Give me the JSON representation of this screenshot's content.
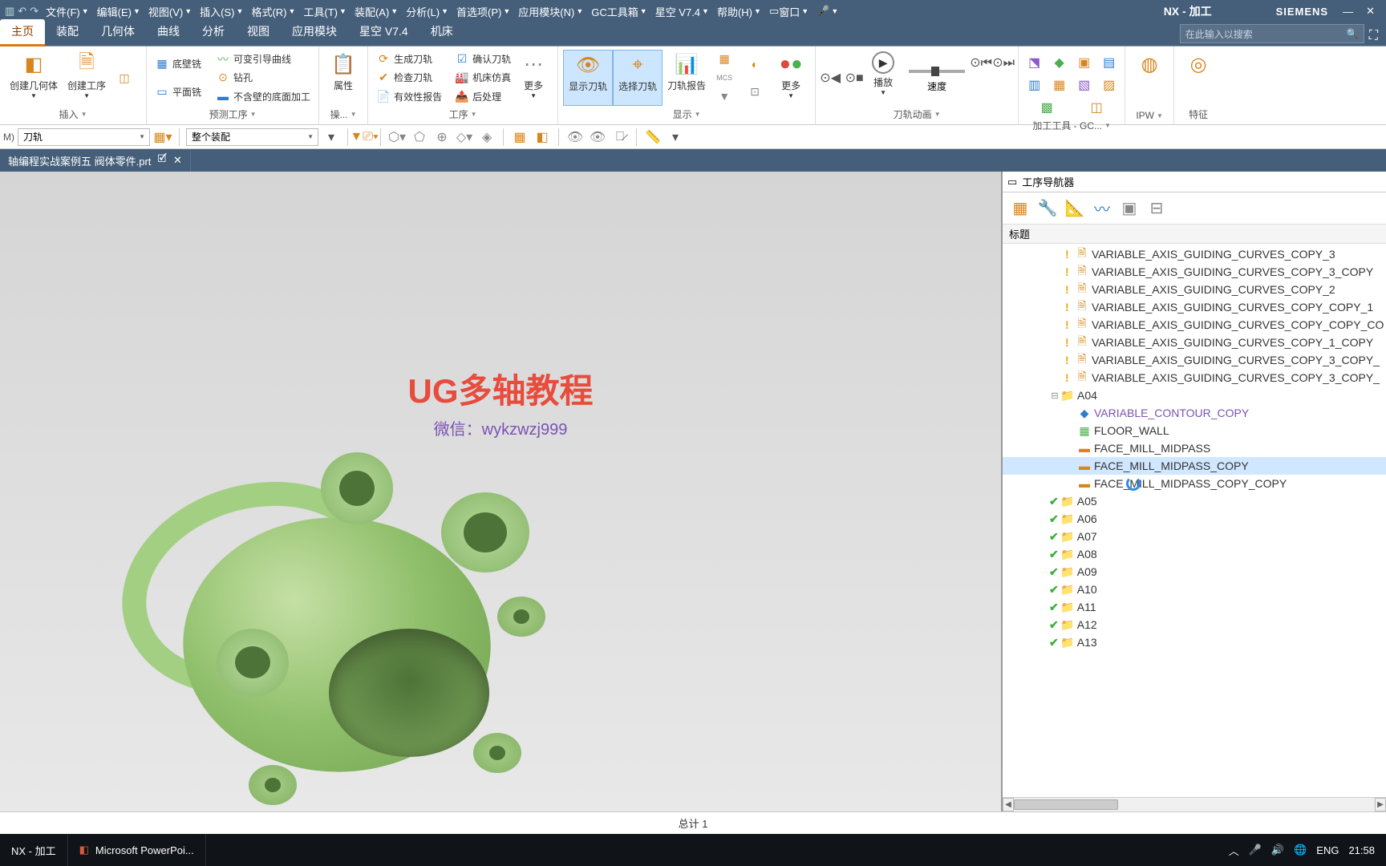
{
  "menubar": {
    "items": [
      "文件(F)",
      "编辑(E)",
      "视图(V)",
      "插入(S)",
      "格式(R)",
      "工具(T)",
      "装配(A)",
      "分析(L)",
      "首选项(P)",
      "应用模块(N)",
      "GC工具箱",
      "星空 V7.4",
      "帮助(H)"
    ],
    "window_menu": "窗口",
    "title": "NX - 加工",
    "brand": "SIEMENS"
  },
  "tabs": [
    "主页",
    "装配",
    "几何体",
    "曲线",
    "分析",
    "视图",
    "应用模块",
    "星空 V7.4",
    "机床"
  ],
  "active_tab": 0,
  "search_placeholder": "在此输入以搜索",
  "ribbon": {
    "g1": {
      "btn1": "创建几何体",
      "btn2": "创建工序",
      "label": "插入"
    },
    "g2": {
      "s1": "底壁铣",
      "s2": "平面铣",
      "s3": "可变引导曲线",
      "s4": "钻孔",
      "s5": "不含壁的底面加工",
      "label": "预测工序"
    },
    "g3": {
      "btn": "属性",
      "label": "操..."
    },
    "g4": {
      "s1": "生成刀轨",
      "s2": "检查刀轨",
      "s3": "有效性报告",
      "s4": "确认刀轨",
      "s5": "机床仿真",
      "s6": "后处理",
      "more": "更多",
      "label": "工序"
    },
    "g5": {
      "b1": "显示刀轨",
      "b2": "选择刀轨",
      "b3": "刀轨报告",
      "label": "显示"
    },
    "g6": {
      "more": "更多",
      "play": "播放",
      "speed": "速度",
      "label": "刀轨动画"
    },
    "g7": {
      "label": "加工工具 - GC..."
    },
    "g8": {
      "label": "IPW"
    },
    "g9": {
      "label": "特征"
    }
  },
  "toolbar2": {
    "sel1": "刀轨",
    "sel2": "整个装配"
  },
  "filetab": "轴编程实战案例五 阀体零件.prt",
  "watermark": {
    "title": "UG多轴教程",
    "sub": "微信：wykzwzj999"
  },
  "navigator": {
    "title": "工序导航器",
    "col": "标题",
    "rows": [
      {
        "indent": 70,
        "warn": true,
        "icon": "op",
        "label": "VARIABLE_AXIS_GUIDING_CURVES_COPY_3"
      },
      {
        "indent": 70,
        "warn": true,
        "icon": "op",
        "label": "VARIABLE_AXIS_GUIDING_CURVES_COPY_3_COPY"
      },
      {
        "indent": 70,
        "warn": true,
        "icon": "op",
        "label": "VARIABLE_AXIS_GUIDING_CURVES_COPY_2"
      },
      {
        "indent": 70,
        "warn": true,
        "icon": "op",
        "label": "VARIABLE_AXIS_GUIDING_CURVES_COPY_COPY_1"
      },
      {
        "indent": 70,
        "warn": true,
        "icon": "op",
        "label": "VARIABLE_AXIS_GUIDING_CURVES_COPY_COPY_CO"
      },
      {
        "indent": 70,
        "warn": true,
        "icon": "op",
        "label": "VARIABLE_AXIS_GUIDING_CURVES_COPY_1_COPY"
      },
      {
        "indent": 70,
        "warn": true,
        "icon": "op",
        "label": "VARIABLE_AXIS_GUIDING_CURVES_COPY_3_COPY_"
      },
      {
        "indent": 70,
        "warn": true,
        "icon": "op",
        "label": "VARIABLE_AXIS_GUIDING_CURVES_COPY_3_COPY_"
      },
      {
        "indent": 50,
        "exp": "-",
        "icon": "folder",
        "label": "A04"
      },
      {
        "indent": 85,
        "icon": "contour",
        "label": "VARIABLE_CONTOUR_COPY",
        "purple": true
      },
      {
        "indent": 85,
        "icon": "floor",
        "label": "FLOOR_WALL"
      },
      {
        "indent": 85,
        "icon": "face",
        "label": "FACE_MILL_MIDPASS"
      },
      {
        "indent": 85,
        "icon": "face",
        "label": "FACE_MILL_MIDPASS_COPY",
        "selected": true
      },
      {
        "indent": 85,
        "icon": "face",
        "label": "FACE_MILL_MIDPASS_COPY_COPY",
        "loading": true
      },
      {
        "indent": 50,
        "check": true,
        "icon": "folder",
        "label": "A05"
      },
      {
        "indent": 50,
        "check": true,
        "icon": "folder",
        "label": "A06"
      },
      {
        "indent": 50,
        "check": true,
        "icon": "folder",
        "label": "A07"
      },
      {
        "indent": 50,
        "check": true,
        "icon": "folder",
        "label": "A08"
      },
      {
        "indent": 50,
        "check": true,
        "icon": "folder",
        "label": "A09"
      },
      {
        "indent": 50,
        "check": true,
        "icon": "folder",
        "label": "A10"
      },
      {
        "indent": 50,
        "check": true,
        "icon": "folder",
        "label": "A11"
      },
      {
        "indent": 50,
        "check": true,
        "icon": "folder",
        "label": "A12"
      },
      {
        "indent": 50,
        "check": true,
        "icon": "folder",
        "label": "A13"
      }
    ]
  },
  "status": "总计 1",
  "taskbar": {
    "btn1": "NX - 加工",
    "btn2": "Microsoft PowerPoi...",
    "lang": "ENG",
    "clock": "21:58"
  }
}
